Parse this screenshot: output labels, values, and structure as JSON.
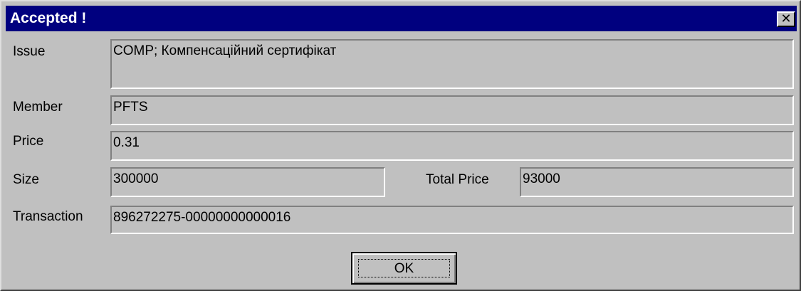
{
  "window": {
    "title": "Accepted !",
    "close_glyph": "✕"
  },
  "fields": {
    "issue": {
      "label": "Issue",
      "value": "COMP; Компенсаційний сертифікат"
    },
    "member": {
      "label": "Member",
      "value": "PFTS"
    },
    "price": {
      "label": "Price",
      "value": "0.31"
    },
    "size": {
      "label": "Size",
      "value": "300000"
    },
    "total_price": {
      "label": "Total Price",
      "value": "93000"
    },
    "transaction": {
      "label": "Transaction",
      "value": "896272275-00000000000016"
    }
  },
  "buttons": {
    "ok_label": "OK"
  },
  "colors": {
    "titlebar": "#00007f",
    "dialog_bg": "#c0c0c0"
  }
}
